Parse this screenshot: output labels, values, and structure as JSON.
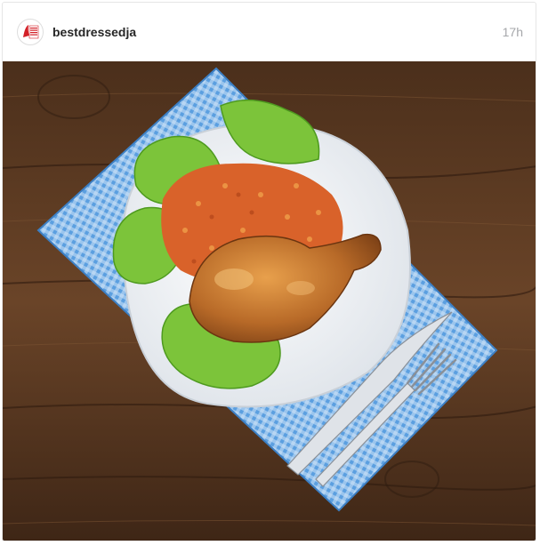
{
  "post": {
    "username": "bestdressedja",
    "timestamp": "17h",
    "avatar_logo_text": [
      "The",
      "Best",
      "Dressed",
      "Chicken"
    ]
  },
  "photo": {
    "subject": "plate of jollof rice with roasted chicken leg on lettuce, blue checkered napkin, knife and fork, wooden table"
  },
  "colors": {
    "wood": "#5a3a22",
    "napkin": "#4a8fd6",
    "plate": "#f4f6f8",
    "lettuce": "#7cc43a",
    "rice": "#d9622a",
    "chicken": "#b9692a",
    "logo_red": "#d32027"
  }
}
